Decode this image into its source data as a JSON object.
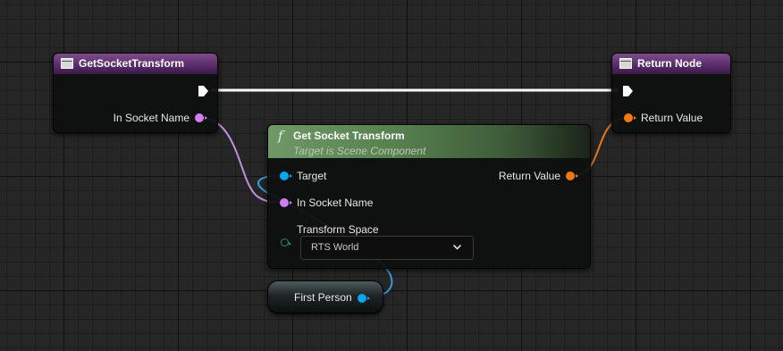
{
  "entry_node": {
    "title": "GetSocketTransform",
    "input_label": "In Socket Name",
    "header_icon": "function-entry-icon"
  },
  "return_node": {
    "title": "Return Node",
    "output_label": "Return Value",
    "header_icon": "function-return-icon"
  },
  "call_node": {
    "title": "Get Socket Transform",
    "subtitle": "Target is Scene Component",
    "function_symbol": "f",
    "pins": {
      "target": "Target",
      "socket_name": "In Socket Name",
      "transform_space": "Transform Space",
      "return_value": "Return Value"
    },
    "transform_space_value": "RTS World"
  },
  "variable_node": {
    "label": "First Person"
  },
  "colors": {
    "object_pin": "#00a8f3",
    "name_pin": "#d27df1",
    "transform_pin": "#f07a0f",
    "enum_pin": "#1f8a7a",
    "exec_pin": "#ffffff"
  }
}
